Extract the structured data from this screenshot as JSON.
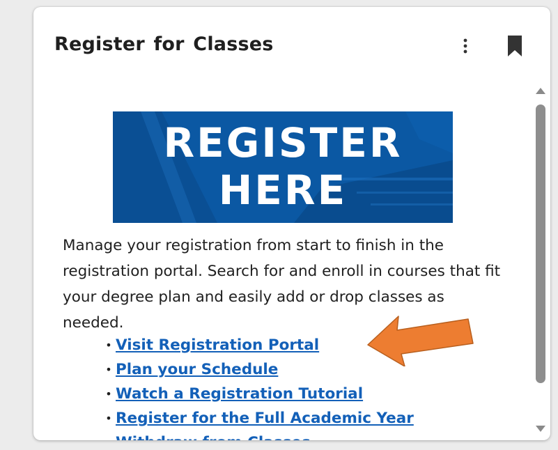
{
  "card": {
    "title": "Register for Classes",
    "menu_icon": "more-vertical-icon",
    "bookmark_icon": "bookmark-icon"
  },
  "banner": {
    "line1": "REGISTER",
    "line2": "HERE",
    "background_color": "#0b58a3"
  },
  "description": "Manage your registration from start to finish in the registration portal. Search for and enroll in courses that fit your degree plan and easily add or drop classes as needed.",
  "links": [
    {
      "label": "Visit Registration Portal"
    },
    {
      "label": "Plan your Schedule"
    },
    {
      "label": "Watch a Registration Tutorial"
    },
    {
      "label": "Register for the Full Academic Year"
    },
    {
      "label": "Withdraw from Classes"
    }
  ],
  "annotation": {
    "icon": "arrow-pointer-icon",
    "color": "#ed7d31",
    "points_to": "Visit Registration Portal"
  },
  "colors": {
    "link": "#1360b8",
    "text": "#1f1f1f"
  }
}
